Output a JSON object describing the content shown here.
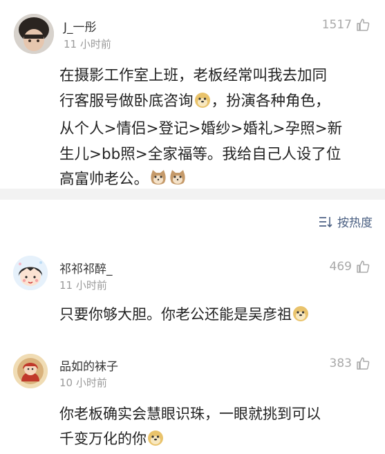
{
  "comments": [
    {
      "user": "J_一彤",
      "time": "11 小时前",
      "likes": "1517",
      "text_lines": [
        "在摄影工作室上班，老板经常叫我去加同",
        "行客服号做卧底咨询",
        "，扮演各种角色，",
        "从个人>情侣>登记>婚纱>婚礼>孕照>新",
        "生儿>bb照>全家福等。我给自己人设了位",
        "高富帅老公。"
      ]
    },
    {
      "user": "祁祁祁醉_",
      "time": "11 小时前",
      "likes": "469",
      "text": "只要你够大胆。你老公还能是吴彦祖"
    },
    {
      "user": "品如的袜子",
      "time": "10 小时前",
      "likes": "383",
      "text_lines": [
        "你老板确实会慧眼识珠，一眼就挑到可以",
        "千变万化的你"
      ]
    }
  ],
  "sort": {
    "label": "按热度"
  },
  "icons": {
    "like": "thumbs-up-icon",
    "sort": "sort-icon",
    "doge": "doge-emoji-icon",
    "cat": "cat-emoji-icon"
  },
  "colors": {
    "link": "#4a5f82",
    "meta": "#9a9a9a",
    "likes": "#a8a8a8",
    "divider": "#f2f2f2"
  }
}
